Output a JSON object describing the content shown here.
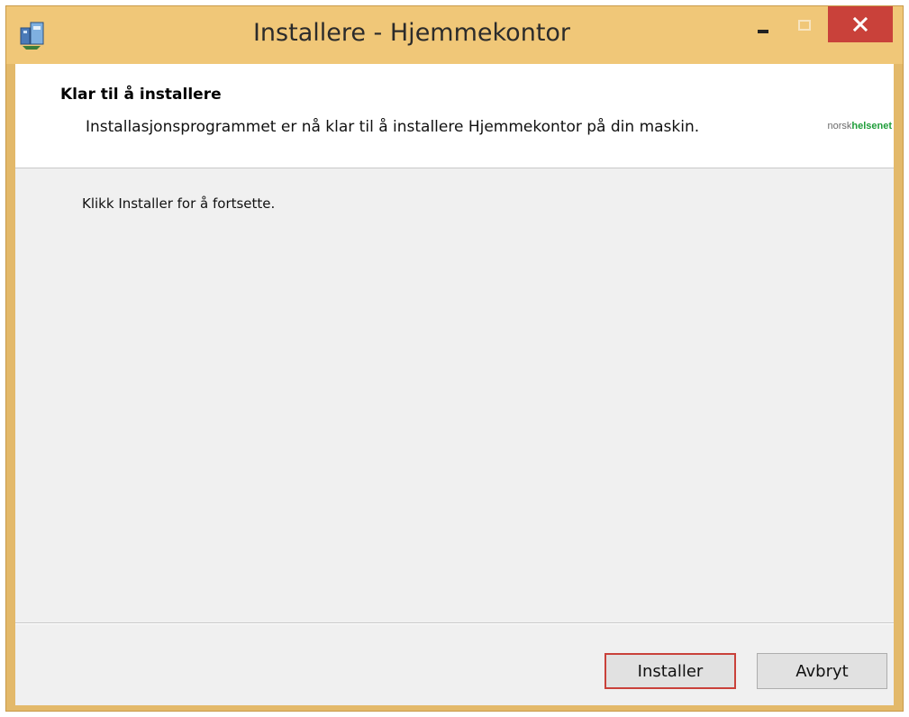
{
  "window": {
    "title": "Installere - Hjemmekontor",
    "controls": {
      "minimize_icon": "minimize-icon",
      "maximize_icon": "maximize-icon",
      "close_icon": "close-icon"
    },
    "accent_color": "#f0c778",
    "close_color": "#c9413a"
  },
  "header": {
    "title": "Klar til å installere",
    "subtitle": "Installasjonsprogrammet er nå klar til å installere Hjemmekontor på din maskin.",
    "logo": {
      "part1": "norsk",
      "part2": "helsenet"
    }
  },
  "main": {
    "instruction": "Klikk Installer for å fortsette."
  },
  "footer": {
    "install_label": "Installer",
    "cancel_label": "Avbryt"
  }
}
